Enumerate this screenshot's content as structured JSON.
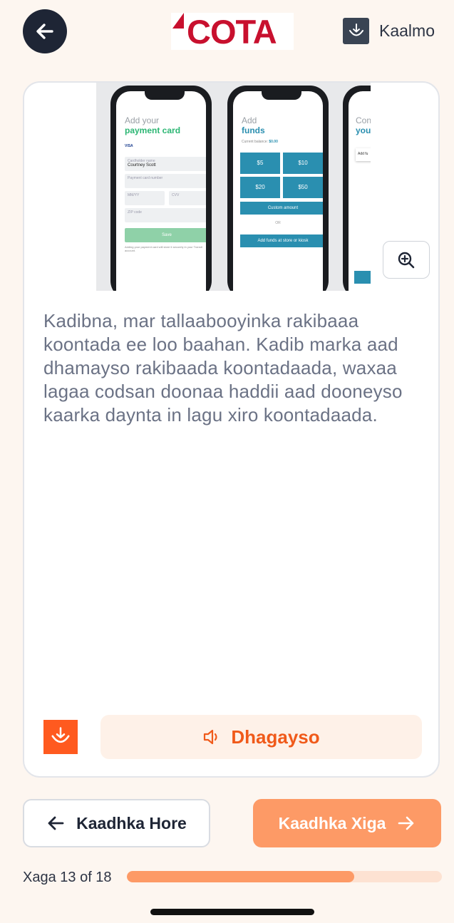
{
  "header": {
    "logo_text": "COTA",
    "help_label": "Kaalmo"
  },
  "card": {
    "screens": [
      {
        "title_line1": "Add your",
        "title_line2": "payment card",
        "card_logos": "VISA",
        "name_label": "Cardholder name",
        "name_value": "Courtney Scott",
        "number_placeholder": "Payment card number",
        "expiry_placeholder": "MM/YY",
        "cvv_placeholder": "CVV",
        "zip_placeholder": "ZIP code",
        "save_label": "Save",
        "footnote": "Adding your payment card will store it securely in your Transit account."
      },
      {
        "title_line1": "Add",
        "title_line2": "funds",
        "balance_label": "Current balance:",
        "balance_value": "$0.00",
        "amounts": [
          "$5",
          "$10",
          "$20",
          "$50"
        ],
        "custom_label": "Custom amount",
        "or_label": "OR",
        "store_label": "Add funds at store or kiosk"
      },
      {
        "title_line1": "Confi",
        "title_line2": "your",
        "button_label": "Add fu"
      }
    ],
    "zoom_icon": "zoom-in-icon",
    "body_text": "Kadibna, mar tallaabooyinka rakibaaa koontada ee loo baahan. Kadib marka aad dhamayso rakibaada koontadaada, waxaa lagaa codsan doonaa haddii aad dooneyso kaarka daynta in lagu xiro koontadaada.",
    "listen_label": "Dhagayso"
  },
  "nav": {
    "prev_label": "Kaadhka Hore",
    "next_label": "Kaadhka Xiga"
  },
  "progress": {
    "step_label": "Xaga 13 of 18",
    "current": 13,
    "total": 18
  },
  "colors": {
    "accent": "#fd9a66",
    "accent_strong": "#f05a1a",
    "brand_red": "#c8102e",
    "dark": "#1e2535",
    "teal": "#2a8fb0"
  }
}
